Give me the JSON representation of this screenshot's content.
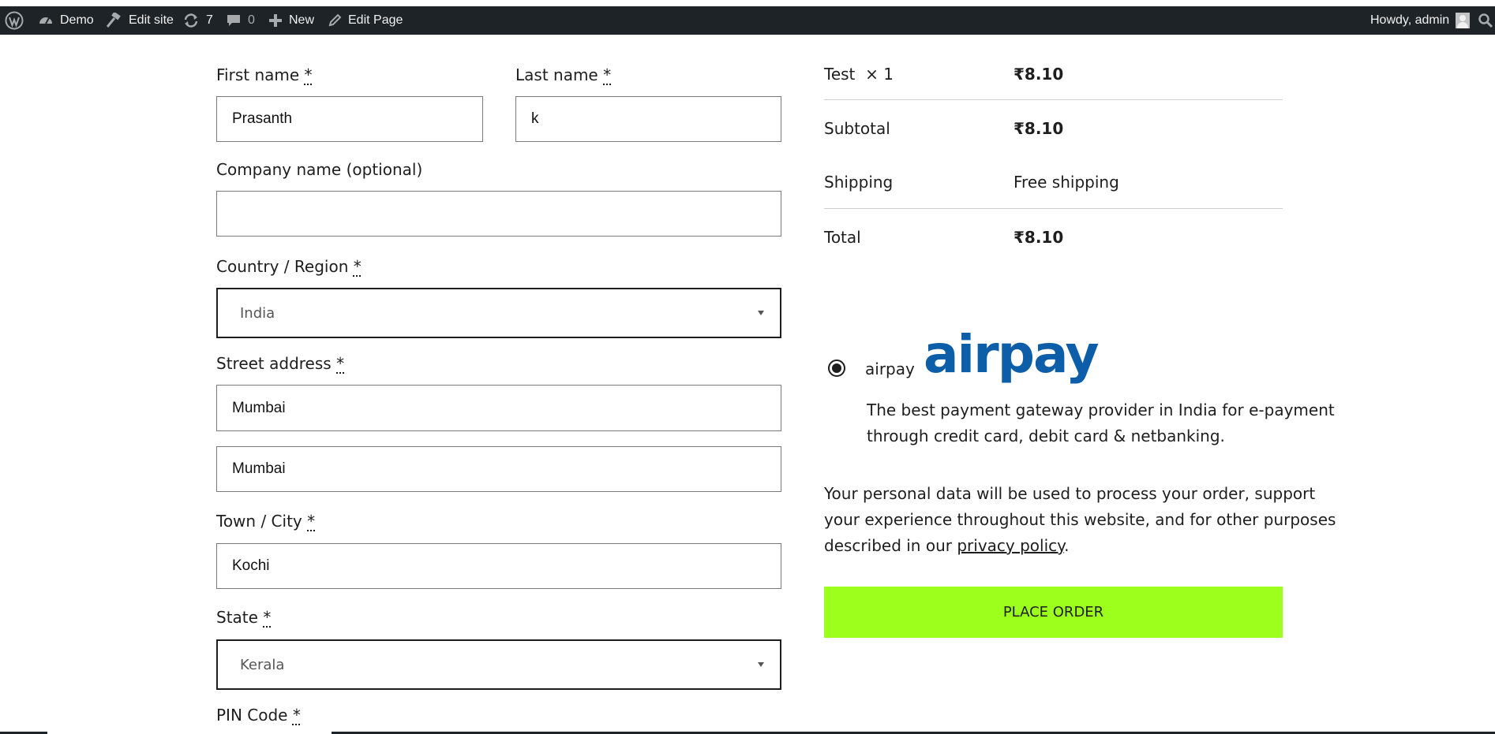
{
  "adminbar": {
    "site_name": "Demo",
    "edit_site": "Edit site",
    "updates_count": "7",
    "comments_count": "0",
    "new_label": "New",
    "edit_page": "Edit Page",
    "howdy": "Howdy, admin"
  },
  "form": {
    "first_name": {
      "label": "First name",
      "required_mark": "*",
      "value": "Prasanth"
    },
    "last_name": {
      "label": "Last name",
      "required_mark": "*",
      "value": "k"
    },
    "company": {
      "label": "Company name (optional)",
      "value": ""
    },
    "country": {
      "label": "Country / Region",
      "required_mark": "*",
      "selected": "India"
    },
    "street": {
      "label": "Street address",
      "required_mark": "*",
      "line1": "Mumbai",
      "line2": "Mumbai"
    },
    "city": {
      "label": "Town / City",
      "required_mark": "*",
      "value": "Kochi"
    },
    "state": {
      "label": "State",
      "required_mark": "*",
      "selected": "Kerala"
    },
    "pin": {
      "label": "PIN Code",
      "required_mark": "*"
    }
  },
  "order": {
    "item_name": "Test",
    "item_qty": "× 1",
    "item_price": "₹8.10",
    "subtotal_label": "Subtotal",
    "subtotal_value": "₹8.10",
    "shipping_label": "Shipping",
    "shipping_value": "Free shipping",
    "total_label": "Total",
    "total_value": "₹8.10"
  },
  "payment": {
    "method_label": "airpay",
    "logo_text": "airpay",
    "description_line1": "The best payment gateway provider in India for e-payment",
    "description_line2": "through credit card, debit card & netbanking.",
    "selected": true
  },
  "privacy": {
    "line1": "Your personal data will be used to process your order, support",
    "line2": "your experience throughout this website, and for other purposes",
    "line3_prefix": "described in our ",
    "link_text": "privacy policy",
    "line3_suffix": "."
  },
  "place_order_label": "PLACE ORDER",
  "colors": {
    "adminbar_bg": "#1d2327",
    "button_bg": "#9dff1c",
    "logo": "#0d5ea8"
  }
}
